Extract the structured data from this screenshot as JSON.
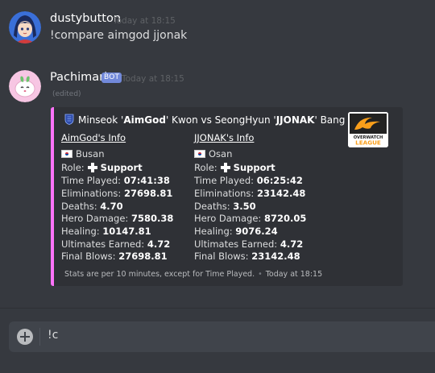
{
  "messages": [
    {
      "username": "dustybutton",
      "timestamp": "Today at 18:15",
      "text": "!compare aimgod jjonak",
      "avatar_icon": "anime-girl-avatar"
    },
    {
      "username": "Pachimari",
      "bot_tag": "BOT",
      "timestamp": "Today at 18:15",
      "edited": "(edited)",
      "avatar_icon": "pachimari-avatar"
    }
  ],
  "embed": {
    "accent_color": "#ff73fa",
    "author": {
      "pre": "Minseok '",
      "name1": "AimGod",
      "mid": "' Kwon vs SeongHyun '",
      "name2": "JJONAK",
      "post": "' Bang"
    },
    "thumbnail": {
      "line1": "OVERWATCH",
      "line2": "LEAGUE"
    },
    "players": [
      {
        "header": "AimGod's Info",
        "city": "Busan",
        "role_label": "Role:",
        "role": "Support",
        "stats": [
          {
            "label": "Time Played: ",
            "value": "07:41:38"
          },
          {
            "label": "Eliminations: ",
            "value": "27698.81"
          },
          {
            "label": "Deaths: ",
            "value": "4.70"
          },
          {
            "label": "Hero Damage: ",
            "value": "7580.38"
          },
          {
            "label": "Healing: ",
            "value": "10147.81"
          },
          {
            "label": "Ultimates Earned: ",
            "value": "4.72"
          },
          {
            "label": "Final Blows: ",
            "value": "27698.81"
          }
        ]
      },
      {
        "header": "JJONAK's Info",
        "city": "Osan",
        "role_label": "Role:",
        "role": "Support",
        "stats": [
          {
            "label": "Time Played: ",
            "value": "06:25:42"
          },
          {
            "label": "Eliminations: ",
            "value": "23142.48"
          },
          {
            "label": "Deaths: ",
            "value": "3.50"
          },
          {
            "label": "Hero Damage: ",
            "value": "8720.05"
          },
          {
            "label": "Healing: ",
            "value": "9076.24"
          },
          {
            "label": "Ultimates Earned: ",
            "value": "4.72"
          },
          {
            "label": "Final Blows: ",
            "value": "23142.48"
          }
        ]
      }
    ],
    "footer": {
      "text": "Stats are per 10 minutes, except for Time Played.",
      "sep": "•",
      "time": "Today at 18:15"
    }
  },
  "composer": {
    "value": "!c"
  }
}
